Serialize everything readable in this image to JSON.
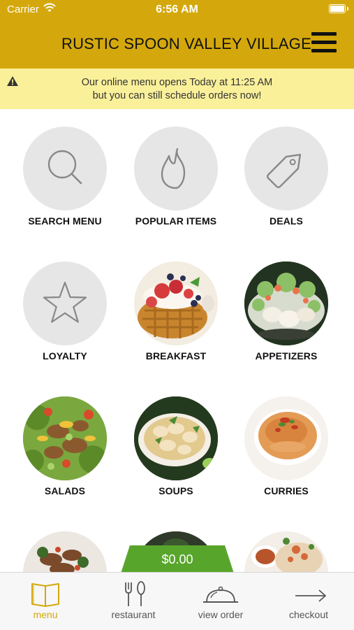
{
  "status_bar": {
    "carrier": "Carrier",
    "time": "6:56 AM"
  },
  "header": {
    "title": "RUSTIC SPOON VALLEY VILLAGE",
    "menu_icon": "hamburger-icon"
  },
  "notice": {
    "line1": "Our online menu opens Today at 11:25 AM",
    "line2": "but you can still schedule orders now!",
    "icon": "warning-icon"
  },
  "tiles": [
    {
      "label": "SEARCH MENU",
      "icon": "search-icon"
    },
    {
      "label": "POPULAR ITEMS",
      "icon": "flame-icon"
    },
    {
      "label": "DEALS",
      "icon": "tag-icon"
    },
    {
      "label": "LOYALTY",
      "icon": "star-icon"
    },
    {
      "label": "BREAKFAST",
      "image": "waffle-photo"
    },
    {
      "label": "APPETIZERS",
      "image": "appetizer-photo"
    },
    {
      "label": "SALADS",
      "image": "salad-photo"
    },
    {
      "label": "SOUPS",
      "image": "soup-photo"
    },
    {
      "label": "CURRIES",
      "image": "curry-photo"
    }
  ],
  "cart": {
    "total": "$0.00"
  },
  "tabbar": {
    "tabs": [
      {
        "label": "menu",
        "icon": "book-icon",
        "active": true
      },
      {
        "label": "restaurant",
        "icon": "fork-knife-icon",
        "active": false
      },
      {
        "label": "view order",
        "icon": "cloche-icon",
        "active": false
      },
      {
        "label": "checkout",
        "icon": "arrow-right-icon",
        "active": false
      }
    ]
  },
  "colors": {
    "header": "#d4a80c",
    "notice": "#faf09a",
    "cart": "#58a52b",
    "active_tab": "#d4a80c",
    "tile_bg": "#e6e6e6"
  }
}
